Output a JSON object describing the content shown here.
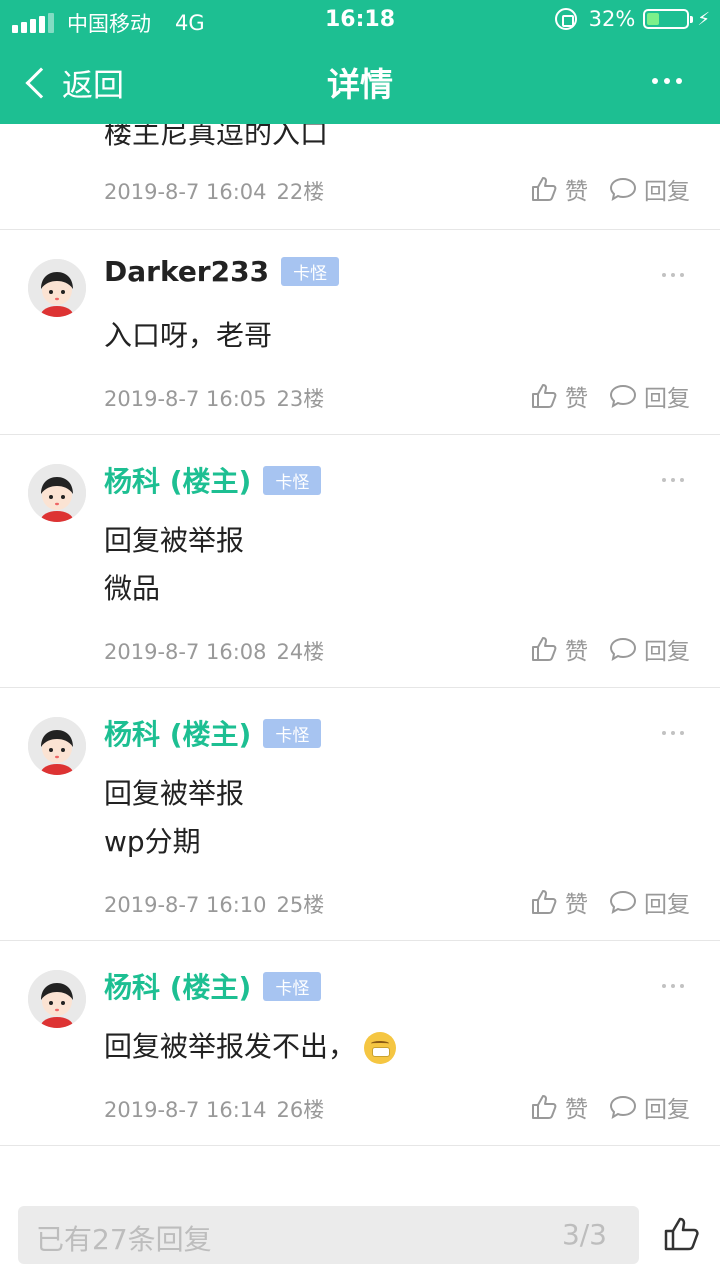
{
  "status_bar": {
    "carrier": "中国移动",
    "network": "4G",
    "time": "16:18",
    "battery_percent_text": "32%",
    "battery_level": 0.32,
    "icons": [
      "signal-icon",
      "orientation-lock-icon",
      "battery-icon",
      "charging-bolt-icon"
    ]
  },
  "nav": {
    "back_label": "返回",
    "title": "详情",
    "more_icon": "more-icon"
  },
  "colors": {
    "brand": "#1dbf92",
    "badge": "#a7c4f1",
    "meta_text": "#999999"
  },
  "posts": [
    {
      "text_lines": [
        "楼主尼真逗的入口"
      ],
      "time": "2019-8-7 16:04",
      "floor": "22楼",
      "like_label": "赞",
      "reply_label": "回复"
    },
    {
      "username": "Darker233",
      "is_op": false,
      "badge": "卡怪",
      "text_lines": [
        "入口呀，老哥"
      ],
      "time": "2019-8-7 16:05",
      "floor": "23楼",
      "like_label": "赞",
      "reply_label": "回复"
    },
    {
      "username": "杨科 (楼主)",
      "is_op": true,
      "badge": "卡怪",
      "text_lines": [
        "回复被举报",
        "微品"
      ],
      "time": "2019-8-7 16:08",
      "floor": "24楼",
      "like_label": "赞",
      "reply_label": "回复"
    },
    {
      "username": "杨科 (楼主)",
      "is_op": true,
      "badge": "卡怪",
      "text_lines": [
        "回复被举报",
        "wp分期"
      ],
      "time": "2019-8-7 16:10",
      "floor": "25楼",
      "like_label": "赞",
      "reply_label": "回复"
    },
    {
      "username": "杨科 (楼主)",
      "is_op": true,
      "badge": "卡怪",
      "text_lines": [
        "回复被举报发不出，"
      ],
      "emoji": "zipped-mouth-emoji-icon",
      "time": "2019-8-7 16:14",
      "floor": "26楼",
      "like_label": "赞",
      "reply_label": "回复"
    }
  ],
  "bottom_bar": {
    "reply_placeholder": "已有27条回复",
    "page_indicator": "3/3",
    "like_icon": "thumbs-up-icon"
  }
}
